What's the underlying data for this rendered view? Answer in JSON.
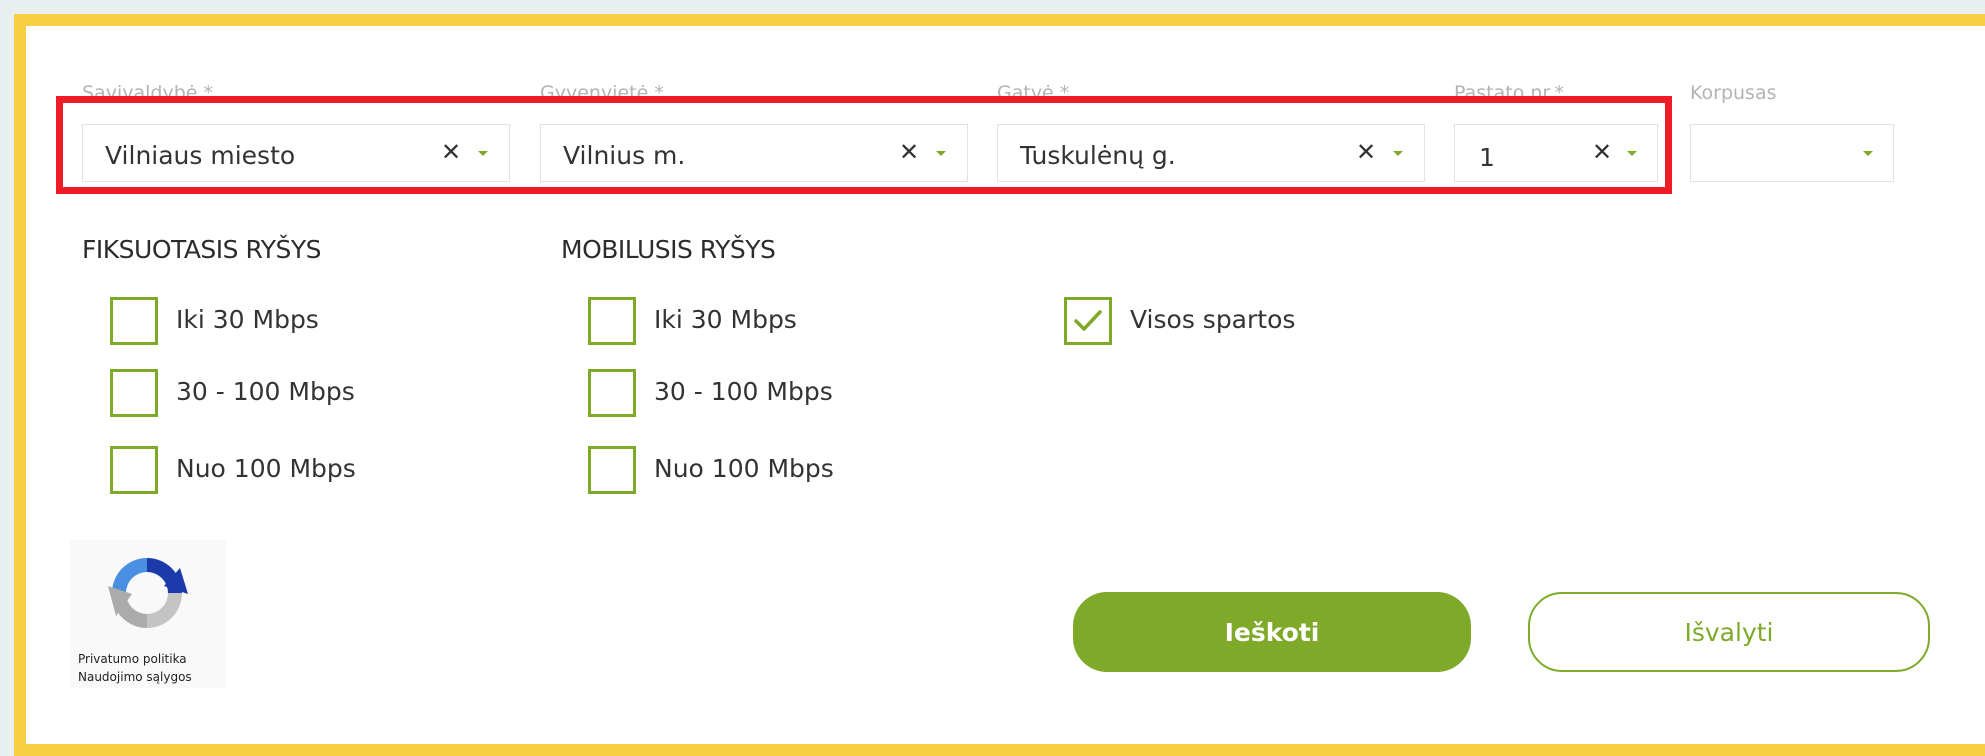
{
  "fields": {
    "municipality": {
      "label": "Savivaldybė *",
      "value": "Vilniaus miesto"
    },
    "settlement": {
      "label": "Gyvenvietė *",
      "value": "Vilnius m."
    },
    "street": {
      "label": "Gatvė *",
      "value": "Tuskulėnų g."
    },
    "building": {
      "label": "Pastato nr.*",
      "value": "1"
    },
    "block": {
      "label": "Korpusas",
      "value": ""
    }
  },
  "fixed": {
    "heading": "FIKSUOTASIS RYŠYS",
    "options": [
      {
        "label": "Iki 30 Mbps",
        "checked": false
      },
      {
        "label": "30 - 100 Mbps",
        "checked": false
      },
      {
        "label": "Nuo 100 Mbps",
        "checked": false
      }
    ]
  },
  "mobile": {
    "heading": "MOBILUSIS RYŠYS",
    "options": [
      {
        "label": "Iki 30 Mbps",
        "checked": false
      },
      {
        "label": "30 - 100 Mbps",
        "checked": false
      },
      {
        "label": "Nuo 100 Mbps",
        "checked": false
      }
    ]
  },
  "all_speeds": {
    "label": "Visos spartos",
    "checked": true
  },
  "recaptcha": {
    "privacy": "Privatumo politika",
    "terms": "Naudojimo sąlygos"
  },
  "actions": {
    "search": "Ieškoti",
    "clear": "Išvalyti"
  },
  "colors": {
    "accent": "#7faa29",
    "frame": "#f8ce43",
    "highlight": "#ee1c25"
  },
  "icons": {
    "clear": "close-icon",
    "dropdown": "chevron-down-icon",
    "check": "checkmark-icon",
    "captcha": "recaptcha-logo"
  }
}
